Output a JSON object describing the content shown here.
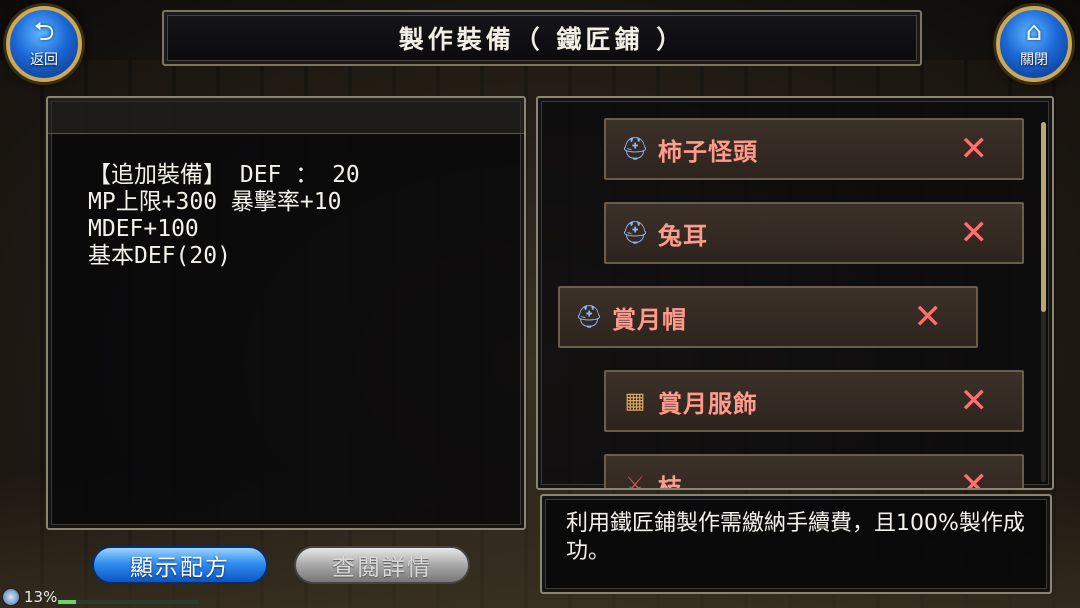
{
  "header": {
    "title": "製作裝備（ 鐵匠鋪 ）",
    "back_label": "返回",
    "close_label": "關閉"
  },
  "stats": {
    "lines": [
      "【追加裝備】 DEF ： 20",
      "MP上限+300 暴擊率+10",
      "MDEF+100",
      "基本DEF(20)"
    ]
  },
  "items": [
    {
      "name": "柿子怪頭",
      "icon": "hat-icon",
      "remove": "✕"
    },
    {
      "name": "兔耳",
      "icon": "hat-icon",
      "remove": "✕"
    },
    {
      "name": "賞月帽",
      "icon": "hat-icon",
      "remove": "✕",
      "selected": true
    },
    {
      "name": "賞月服飾",
      "icon": "chest-icon",
      "remove": "✕"
    },
    {
      "name": "枝",
      "icon": "sword-icon",
      "remove": "✕"
    }
  ],
  "message": "利用鐵匠鋪製作需繳納手續費，且100%製作成功。",
  "buttons": {
    "show_recipe": "顯示配方",
    "view_detail": "查閱詳情"
  },
  "status": {
    "percent": "13%",
    "exp_fraction": 0.13
  },
  "colors": {
    "accent_blue": "#1c68d6",
    "item_text": "#ff9b8c",
    "remove_x": "#ff6f6f"
  }
}
